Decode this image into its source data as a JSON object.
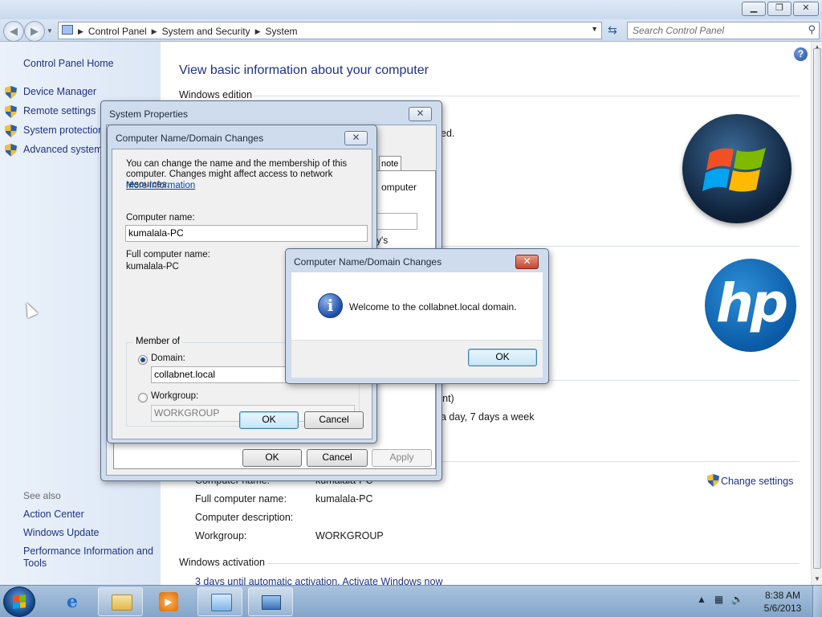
{
  "address_bar": {
    "breadcrumbs": [
      "Control Panel",
      "System and Security",
      "System"
    ],
    "search_placeholder": "Search Control Panel"
  },
  "left_pane": {
    "home": "Control Panel Home",
    "tasks": [
      "Device Manager",
      "Remote settings",
      "System protection",
      "Advanced system"
    ],
    "see_also_title": "See also",
    "see_also": [
      "Action Center",
      "Windows Update",
      "Performance Information and Tools"
    ]
  },
  "content": {
    "title": "View basic information about your computer",
    "section_windows_edition": "Windows edition",
    "section_windows_activation": "Windows activation",
    "fragments": {
      "reserved": "ed.",
      "rent": "rent)",
      "support": "a day, 7 days a week"
    },
    "computer_settings": {
      "labels": [
        "Computer name:",
        "Full computer name:",
        "Computer description:",
        "Workgroup:"
      ],
      "values": [
        "kumalala-PC",
        "kumalala-PC",
        "",
        "WORKGROUP"
      ]
    },
    "change_settings": "Change settings",
    "activation_link": "3 days until automatic activation. Activate Windows now"
  },
  "system_properties": {
    "title": "System Properties",
    "tab_fragment": "note",
    "frag_computer": "omputer",
    "frag_s": "y's",
    "buttons": {
      "ok": "OK",
      "cancel": "Cancel",
      "apply": "Apply"
    }
  },
  "name_change_dialog": {
    "title": "Computer Name/Domain Changes",
    "description": "You can change the name and the membership of this computer. Changes might affect access to network resources.",
    "more_info": "More information",
    "computer_name_label": "Computer name:",
    "computer_name_value": "kumalala-PC",
    "full_name_label": "Full computer name:",
    "full_name_value": "kumalala-PC",
    "member_of": "Member of",
    "domain_label": "Domain:",
    "domain_value": "collabnet.local",
    "workgroup_label": "Workgroup:",
    "workgroup_value": "WORKGROUP",
    "selected": "domain",
    "buttons": {
      "ok": "OK",
      "cancel": "Cancel"
    }
  },
  "welcome_dialog": {
    "title": "Computer Name/Domain Changes",
    "message": "Welcome to the collabnet.local domain.",
    "ok": "OK"
  },
  "taskbar": {
    "time": "8:38 AM",
    "date": "5/6/2013"
  },
  "colors": {
    "link_blue": "#1e3287",
    "title_blue": "#1e3287",
    "taskbar": "#9bb8d8"
  }
}
